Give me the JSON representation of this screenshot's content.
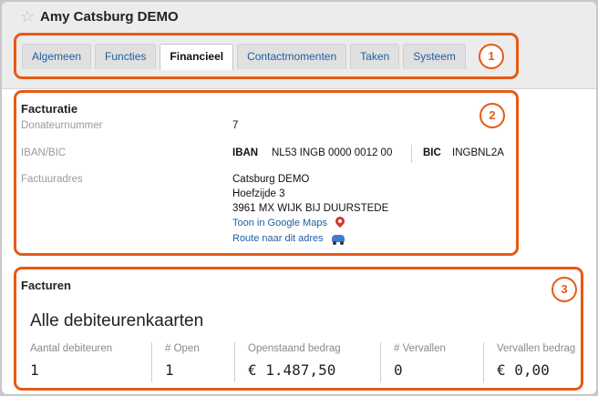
{
  "window": {
    "title": "Amy Catsburg DEMO"
  },
  "tabs": [
    {
      "label": "Algemeen",
      "active": false
    },
    {
      "label": "Functies",
      "active": false
    },
    {
      "label": "Financieel",
      "active": true
    },
    {
      "label": "Contactmomenten",
      "active": false
    },
    {
      "label": "Taken",
      "active": false
    },
    {
      "label": "Systeem",
      "active": false
    }
  ],
  "callouts": {
    "one": "1",
    "two": "2",
    "three": "3"
  },
  "colors": {
    "highlight": "#e65a14",
    "link": "#1f5fa0",
    "active_tab": "#ffffff"
  },
  "facturatie": {
    "title": "Facturatie",
    "donateurnummer_label": "Donateurnummer",
    "donateurnummer_value": "7",
    "iban_bic_label": "IBAN/BIC",
    "iban_tag": "IBAN",
    "iban_value": "NL53 INGB 0000 0012 00",
    "bic_tag": "BIC",
    "bic_value": "INGBNL2A",
    "factuuradres_label": "Factuuradres",
    "address_line1": "Catsburg DEMO",
    "address_line2": "Hoefzijde 3",
    "address_line3": "3961 MX  WIJK BIJ DUURSTEDE",
    "maps_link": "Toon in Google Maps",
    "route_link": "Route naar dit adres",
    "icons": {
      "maps": "map-pin-icon",
      "route": "car-icon"
    }
  },
  "facturen": {
    "title": "Facturen",
    "subtitle": "Alle debiteurenkaarten",
    "stats": [
      {
        "label": "Aantal debiteuren",
        "value": "1"
      },
      {
        "label": "# Open",
        "value": "1"
      },
      {
        "label": "Openstaand bedrag",
        "value": "€ 1.487,50"
      },
      {
        "label": "# Vervallen",
        "value": "0"
      },
      {
        "label": "Vervallen bedrag",
        "value": "€ 0,00"
      }
    ]
  }
}
